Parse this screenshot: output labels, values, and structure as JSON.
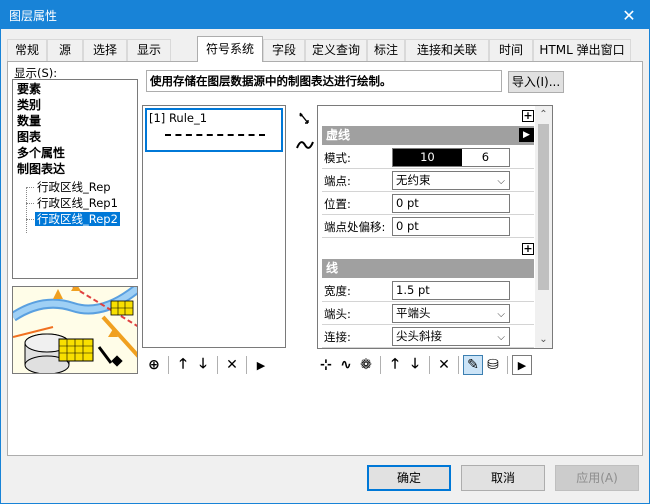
{
  "window": {
    "title": "图层属性",
    "close_glyph": "✕"
  },
  "tabs": [
    {
      "label": "常规"
    },
    {
      "label": "源"
    },
    {
      "label": "选择"
    },
    {
      "label": "显示"
    },
    {
      "label": "符号系统"
    },
    {
      "label": "字段"
    },
    {
      "label": "定义查询"
    },
    {
      "label": "标注"
    },
    {
      "label": "连接和关联"
    },
    {
      "label": "时间"
    },
    {
      "label": "HTML 弹出窗口"
    }
  ],
  "active_tab": "符号系统",
  "show_panel": {
    "label": "显示(S):",
    "tree": [
      {
        "label": "要素"
      },
      {
        "label": "类别"
      },
      {
        "label": "数量"
      },
      {
        "label": "图表"
      },
      {
        "label": "多个属性"
      },
      {
        "label": "制图表达"
      }
    ],
    "sub_items": [
      {
        "label": "行政区线_Rep"
      },
      {
        "label": "行政区线_Rep1"
      },
      {
        "label": "行政区线_Rep2"
      }
    ],
    "selected": "行政区线_Rep2"
  },
  "description": "使用存储在图层数据源中的制图表达进行绘制。",
  "import_button": "导入(I)...",
  "rules": [
    {
      "label": "[1] Rule_1"
    }
  ],
  "properties": {
    "dash_section": {
      "title": "虚线",
      "pattern_label": "模式:",
      "pattern_values": [
        "10",
        "6"
      ],
      "endpoint_label": "端点:",
      "endpoint_value": "无约束",
      "position_label": "位置:",
      "position_value": "0 pt",
      "endpoint_offset_label": "端点处偏移:",
      "endpoint_offset_value": "0 pt"
    },
    "line_section": {
      "title": "线",
      "width_label": "宽度:",
      "width_value": "1.5 pt",
      "cap_label": "端头:",
      "cap_value": "平端头",
      "join_label": "连接:",
      "join_value": "尖头斜接"
    }
  },
  "footer": {
    "ok": "确定",
    "cancel": "取消",
    "apply": "应用(A)"
  }
}
